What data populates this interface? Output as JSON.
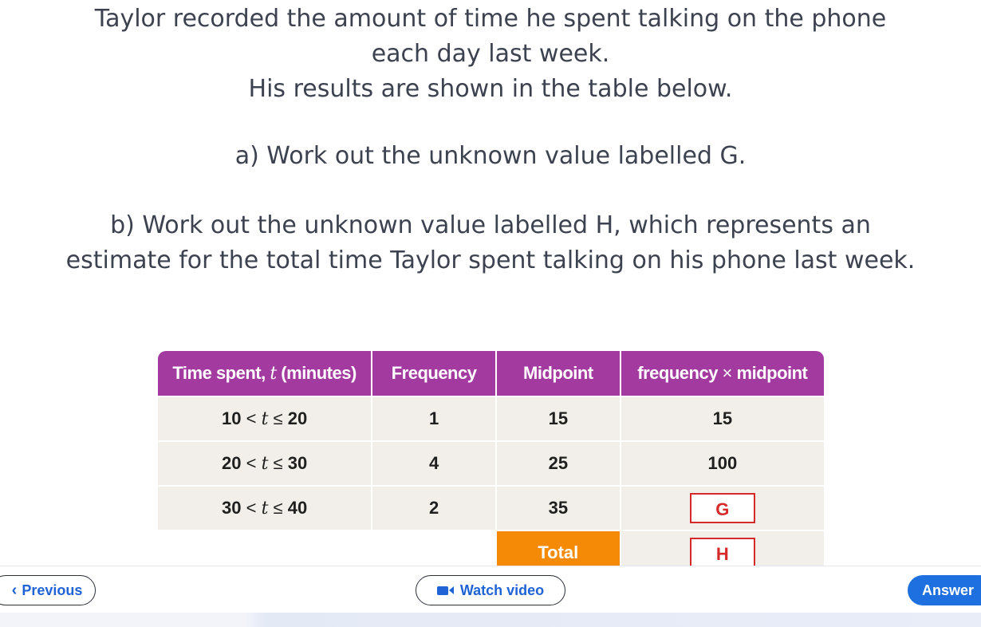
{
  "question": {
    "intro_line1": "Taylor recorded the amount of time he spent talking on the phone",
    "intro_line2": "each day last week.",
    "intro_line3": "His results are shown in the table below.",
    "part_a": "a) Work out the unknown value labelled G.",
    "part_b_line1": "b) Work out the unknown value labelled H, which represents an",
    "part_b_line2": "estimate for the total time Taylor spent talking on his phone last week."
  },
  "table": {
    "headers": {
      "col1_prefix": "Time spent, ",
      "col1_var": "t",
      "col1_suffix": " (minutes)",
      "col2": "Frequency",
      "col3": "Midpoint",
      "col4_prefix": "frequency ",
      "col4_op": "×",
      "col4_suffix": " midpoint"
    },
    "rows": [
      {
        "low": "10",
        "lt": "<",
        "var": "t",
        "le": "≤",
        "high": "20",
        "frequency": "1",
        "midpoint": "15",
        "product": "15"
      },
      {
        "low": "20",
        "lt": "<",
        "var": "t",
        "le": "≤",
        "high": "30",
        "frequency": "4",
        "midpoint": "25",
        "product": "100"
      },
      {
        "low": "30",
        "lt": "<",
        "var": "t",
        "le": "≤",
        "high": "40",
        "frequency": "2",
        "midpoint": "35",
        "product": "G"
      }
    ],
    "total_label": "Total",
    "total_value": "H"
  },
  "nav": {
    "previous_label": "Previous",
    "video_label": "Watch video",
    "answer_label": "Answer"
  },
  "icons": {
    "previous": "chevron-left-icon",
    "video": "video-camera-icon"
  },
  "colors": {
    "header_bg": "#a33aa0",
    "cell_bg": "#f2efea",
    "total_bg": "#f58a07",
    "answer_box_border": "#d62a2a",
    "primary_blue": "#1e6fe0"
  }
}
